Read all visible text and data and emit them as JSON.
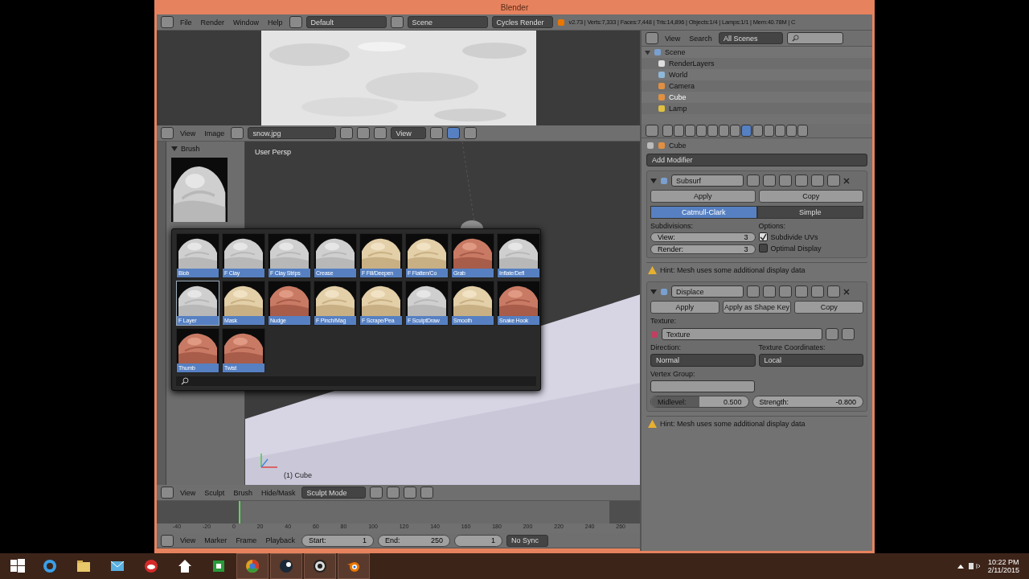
{
  "window": {
    "title": "Blender"
  },
  "menu_bar": {
    "menus": [
      "File",
      "Render",
      "Window",
      "Help"
    ],
    "layout": "Default",
    "scene": "Scene",
    "engine": "Cycles Render",
    "stats": "v2.73 | Verts:7,333 | Faces:7,448 | Tris:14,896 | Objects:1/4 | Lamps:1/1 | Mem:40.78M | C"
  },
  "image_editor": {
    "menus": [
      "View",
      "Image"
    ],
    "image_name": "snow.jpg",
    "view": "View"
  },
  "tool_shelf": {
    "panel": "Brush",
    "expanded": true
  },
  "viewport": {
    "label": "User Persp",
    "object": "(1) Cube",
    "header_menus": [
      "View",
      "Sculpt",
      "Brush",
      "Hide/Mask"
    ],
    "mode": "Sculpt Mode"
  },
  "brush_popup": {
    "brushes": [
      {
        "name": "Blob",
        "kind": "grey",
        "selected": false
      },
      {
        "name": "F Clay",
        "kind": "grey",
        "selected": false
      },
      {
        "name": "F Clay Strips",
        "kind": "grey",
        "selected": false
      },
      {
        "name": "Crease",
        "kind": "grey",
        "selected": false
      },
      {
        "name": "F Fill/Deepen",
        "kind": "tan",
        "selected": false
      },
      {
        "name": "F Flatten/Co",
        "kind": "tan",
        "selected": false
      },
      {
        "name": "Grab",
        "kind": "pink",
        "selected": false
      },
      {
        "name": "Inflate/Defl",
        "kind": "grey",
        "selected": false
      },
      {
        "name": "F Layer",
        "kind": "grey",
        "selected": true
      },
      {
        "name": "Mask",
        "kind": "tan",
        "selected": false
      },
      {
        "name": "Nudge",
        "kind": "pink",
        "selected": false
      },
      {
        "name": "F Pinch/Mag",
        "kind": "tan",
        "selected": false
      },
      {
        "name": "F Scrape/Pea",
        "kind": "tan",
        "selected": false
      },
      {
        "name": "F SculptDraw",
        "kind": "grey",
        "selected": false
      },
      {
        "name": "Smooth",
        "kind": "tan",
        "selected": false
      },
      {
        "name": "Snake Hook",
        "kind": "pink",
        "selected": false
      },
      {
        "name": "Thumb",
        "kind": "pink",
        "selected": false
      },
      {
        "name": "Twist",
        "kind": "pink",
        "selected": false
      }
    ]
  },
  "timeline": {
    "ticks": [
      "-40",
      "-20",
      "0",
      "20",
      "40",
      "60",
      "80",
      "100",
      "120",
      "140",
      "160",
      "180",
      "200",
      "220",
      "240",
      "260"
    ],
    "playhead": {
      "level": 0.17
    },
    "menus": [
      "View",
      "Marker",
      "Frame",
      "Playback"
    ],
    "start_label": "Start:",
    "start": "1",
    "end_label": "End:",
    "end": "250",
    "current": "1",
    "sync": "No Sync"
  },
  "outliner": {
    "menus": [
      "View",
      "Search"
    ],
    "filter": "All Scenes",
    "tree": [
      {
        "name": "Scene",
        "kind": "scene",
        "expanded": true,
        "selected": false,
        "children": [
          {
            "name": "RenderLayers",
            "kind": "layers",
            "selected": false
          },
          {
            "name": "World",
            "kind": "world",
            "selected": false
          },
          {
            "name": "Camera",
            "kind": "camera",
            "selected": false
          },
          {
            "name": "Cube",
            "kind": "mesh",
            "selected": true
          },
          {
            "name": "Lamp",
            "kind": "lamp",
            "selected": false
          }
        ]
      }
    ]
  },
  "properties": {
    "tabs": [
      {
        "selected": false
      },
      {
        "selected": false
      },
      {
        "selected": false
      },
      {
        "selected": false
      },
      {
        "selected": false
      },
      {
        "selected": false
      },
      {
        "selected": false
      },
      {
        "selected": true
      },
      {
        "selected": false
      },
      {
        "selected": false
      },
      {
        "selected": false
      },
      {
        "selected": false
      },
      {
        "selected": false
      }
    ],
    "object": "Cube",
    "add_modifier": "Add Modifier",
    "modifiers": [
      {
        "kind": "subsurf",
        "name": "Subsurf",
        "buttons": [
          "Apply",
          "Copy"
        ],
        "algorithms": [
          {
            "label": "Catmull-Clark",
            "selected": true
          },
          {
            "label": "Simple",
            "selected": false
          }
        ],
        "subdivisions_label": "Subdivisions:",
        "fields": [
          {
            "label": "View:",
            "value": "3"
          },
          {
            "label": "Render:",
            "value": "3"
          }
        ],
        "options_label": "Options:",
        "options": [
          {
            "label": "Subdivide UVs",
            "checked": true
          },
          {
            "label": "Optimal Display",
            "checked": false
          }
        ],
        "hint": "Hint: Mesh uses some additional display data"
      },
      {
        "kind": "displace",
        "name": "Displace",
        "buttons": [
          "Apply",
          "Apply as Shape Key",
          "Copy"
        ],
        "texture_label": "Texture:",
        "texture": "Texture",
        "direction_label": "Direction:",
        "direction": "Normal",
        "coords_label": "Texture Coordinates:",
        "coords": "Local",
        "vgroup_label": "Vertex Group:",
        "midlevel": {
          "label": "Midlevel:",
          "value": "0.500",
          "level": 0.5
        },
        "strength": {
          "label": "Strength:",
          "value": "-0.800"
        },
        "hint": "Hint: Mesh uses some additional display data"
      }
    ]
  },
  "taskbar": {
    "apps": [
      {
        "kind": "ie",
        "running": false
      },
      {
        "kind": "folder",
        "running": false
      },
      {
        "kind": "mail",
        "running": false
      },
      {
        "kind": "cloud",
        "running": false
      },
      {
        "kind": "home",
        "running": false
      },
      {
        "kind": "sheet",
        "running": false
      },
      {
        "kind": "chrome",
        "running": true
      },
      {
        "kind": "steam",
        "running": true
      },
      {
        "kind": "obs",
        "running": true
      },
      {
        "kind": "blender",
        "running": true
      }
    ],
    "time": "10:22 PM",
    "date": "2/11/2015"
  }
}
